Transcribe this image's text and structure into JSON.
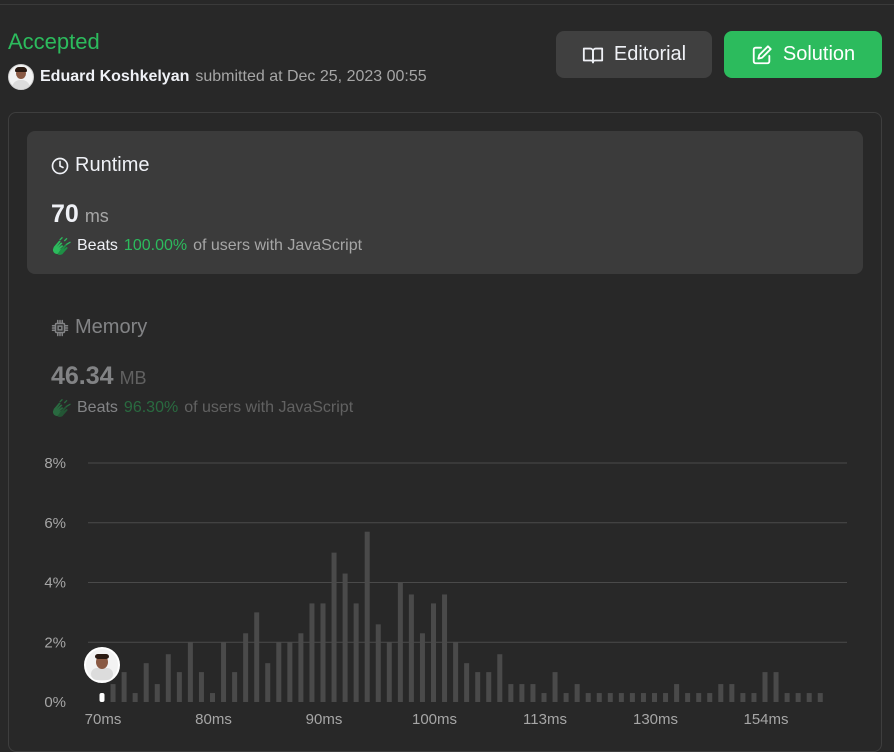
{
  "submission": {
    "status": "Accepted",
    "user_name": "Eduard Koshkelyan",
    "submitted_text": "submitted at Dec 25, 2023 00:55"
  },
  "buttons": {
    "editorial": "Editorial",
    "solution": "Solution"
  },
  "runtime": {
    "title": "Runtime",
    "value": "70",
    "unit": "ms",
    "beats_label": "Beats",
    "beats_pct": "100.00%",
    "beats_suffix": "of users with JavaScript"
  },
  "memory": {
    "title": "Memory",
    "value": "46.34",
    "unit": "MB",
    "beats_label": "Beats",
    "beats_pct": "96.30%",
    "beats_suffix": "of users with JavaScript"
  },
  "colors": {
    "accent_green": "#2cbb5d",
    "bar": "#4a4a4a",
    "grid": "#4a4a4a"
  },
  "chart_data": {
    "type": "bar",
    "ylim": [
      0,
      8
    ],
    "y_ticks": [
      "0%",
      "2%",
      "4%",
      "6%",
      "8%"
    ],
    "x_tick_labels": [
      "70ms",
      "80ms",
      "90ms",
      "100ms",
      "113ms",
      "130ms",
      "154ms"
    ],
    "x_tick_bar_index": [
      0,
      10,
      20,
      30,
      40,
      50,
      60
    ],
    "highlight_index": 0,
    "values": [
      0.3,
      0.6,
      1.0,
      0.3,
      1.3,
      0.6,
      1.6,
      1.0,
      2.0,
      1.0,
      0.3,
      2.0,
      1.0,
      2.3,
      3.0,
      1.3,
      2.0,
      2.0,
      2.3,
      3.3,
      3.3,
      5.0,
      4.3,
      3.3,
      5.7,
      2.6,
      2.0,
      4.0,
      3.6,
      2.3,
      3.3,
      3.6,
      2.0,
      1.3,
      1.0,
      1.0,
      1.6,
      0.6,
      0.6,
      0.6,
      0.3,
      1.0,
      0.3,
      0.6,
      0.3,
      0.3,
      0.3,
      0.3,
      0.3,
      0.3,
      0.3,
      0.3,
      0.6,
      0.3,
      0.3,
      0.3,
      0.6,
      0.6,
      0.3,
      0.3,
      1.0,
      1.0,
      0.3,
      0.3,
      0.3,
      0.3
    ]
  }
}
